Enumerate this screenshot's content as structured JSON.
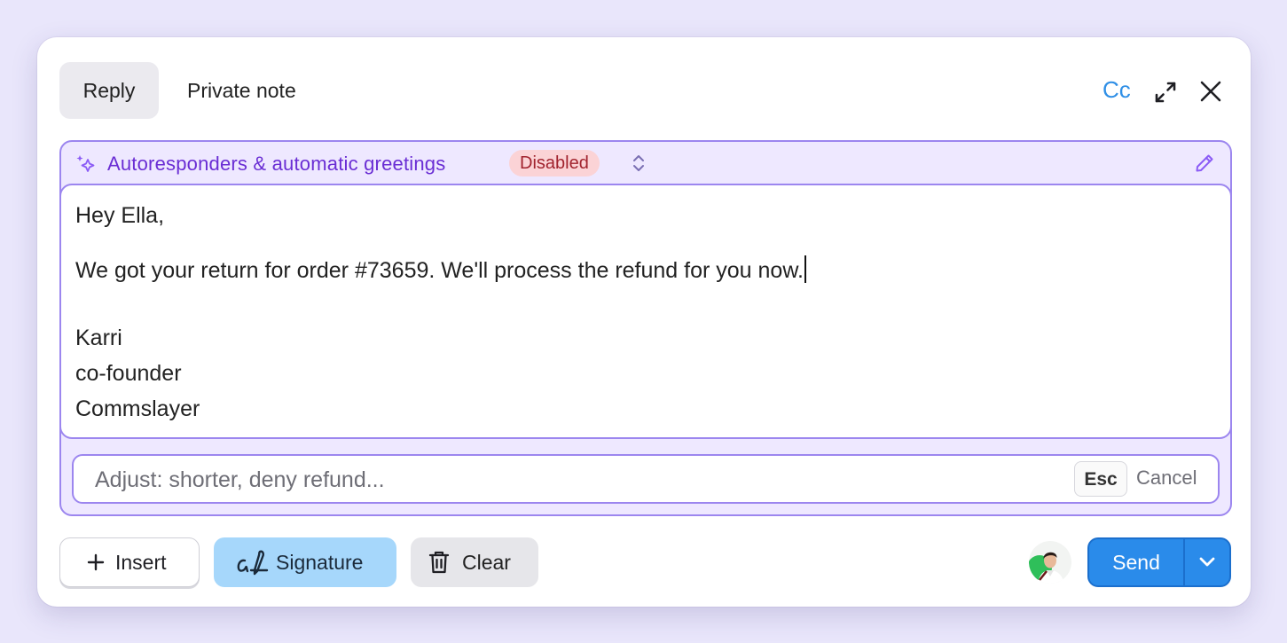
{
  "header": {
    "tabs": [
      {
        "label": "Reply",
        "active": true
      },
      {
        "label": "Private note",
        "active": false
      }
    ],
    "cc_label": "Cc",
    "expand_icon": "expand-icon",
    "close_icon": "close-icon"
  },
  "autoresponder": {
    "title": "Autoresponders & automatic greetings",
    "status": "Disabled",
    "icon": "sparkle-icon"
  },
  "message": {
    "greeting": "Hey Ella,",
    "body": "We got your return for order #73659. We'll process the refund for you now.",
    "signature": [
      "Karri",
      "co-founder",
      "Commslayer"
    ]
  },
  "adjust": {
    "placeholder": "Adjust: shorter, deny refund...",
    "esc_key": "Esc",
    "cancel_label": "Cancel"
  },
  "toolbar": {
    "insert_label": "Insert",
    "signature_label": "Signature",
    "clear_label": "Clear",
    "send_label": "Send"
  },
  "colors": {
    "accent": "#2a8bea",
    "purple": "#6a2ed4",
    "panel_border": "#9c86ef",
    "badge_bg": "#fbd3d6",
    "badge_text": "#a1232e",
    "signature_bg": "#a6d7fb"
  }
}
